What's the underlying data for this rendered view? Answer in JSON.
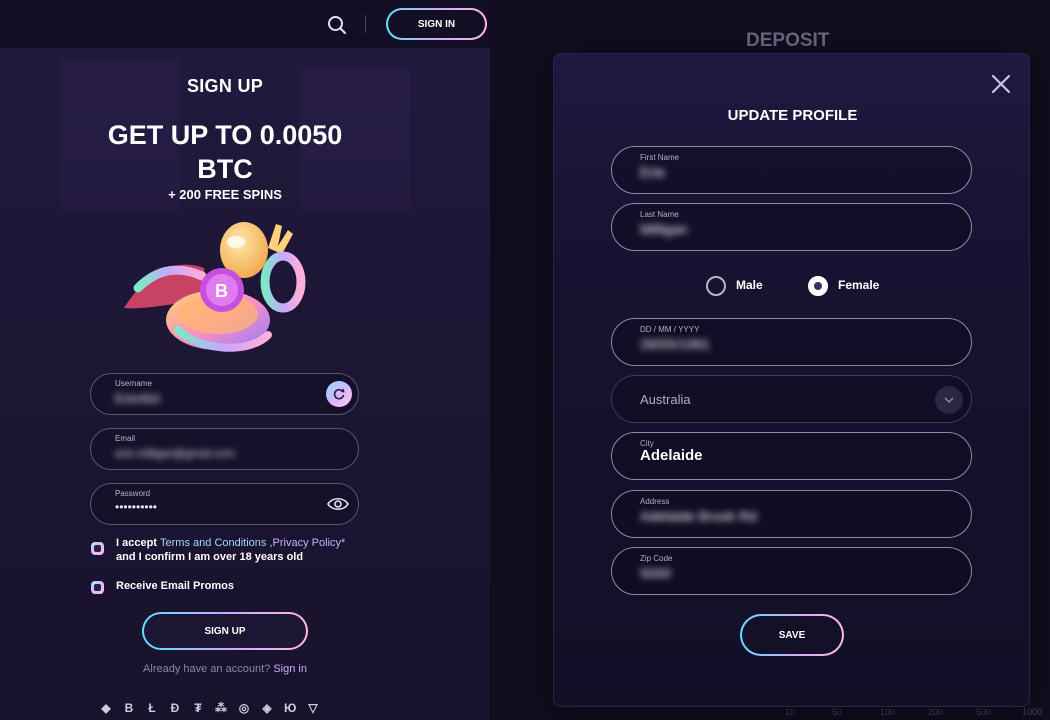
{
  "header": {
    "search_icon": "search-icon",
    "signin_label": "SIGN IN"
  },
  "signup": {
    "title": "SIGN UP",
    "promo_title": "GET UP TO 0.0050 BTC",
    "promo_sub": "+ 200 FREE SPINS",
    "username": {
      "label": "Username",
      "value": "Erie464"
    },
    "email": {
      "label": "Email",
      "value": "erie.milligan@gmail.com"
    },
    "password": {
      "label": "Password",
      "value": "••••••••••"
    },
    "terms_prefix": "I accept ",
    "terms_link": "Terms and Conditions",
    "terms_sep": " ,",
    "privacy_link": "Privacy Policy*",
    "terms_suffix": "and I confirm I am over 18 years old",
    "promos_label": "Receive Email Promos",
    "signup_button": "SIGN UP",
    "already_text": "Already have an account?",
    "signin_link": "Sign in",
    "crypto_icons": [
      "◆",
      "B",
      "Ł",
      "Đ",
      "₮",
      "⁂",
      "◎",
      "◈",
      "Ю",
      "▽"
    ]
  },
  "backdrop": {
    "title": "DEPOSIT",
    "ticks": [
      "10",
      "50",
      "100",
      "200",
      "500",
      "1000"
    ]
  },
  "profile": {
    "title": "UPDATE PROFILE",
    "first_name": {
      "label": "First Name",
      "value": "Erie"
    },
    "last_name": {
      "label": "Last Name",
      "value": "Milligan"
    },
    "gender": {
      "male": "Male",
      "female": "Female",
      "selected": "Female"
    },
    "dob": {
      "label": "DD / MM / YYYY",
      "value": "28/05/1991"
    },
    "country": "Australia",
    "city": {
      "label": "City",
      "value": "Adelaide"
    },
    "address": {
      "label": "Address",
      "value": "Adelaide Brook Rd"
    },
    "zip": {
      "label": "Zip Code",
      "value": "5000"
    },
    "save_button": "SAVE"
  },
  "colors": {
    "accent_gradient": [
      "#5ee0ff",
      "#c9a8ff",
      "#ffb8e0"
    ],
    "link": "#9fd8ff",
    "background": "#0f0b1d"
  }
}
